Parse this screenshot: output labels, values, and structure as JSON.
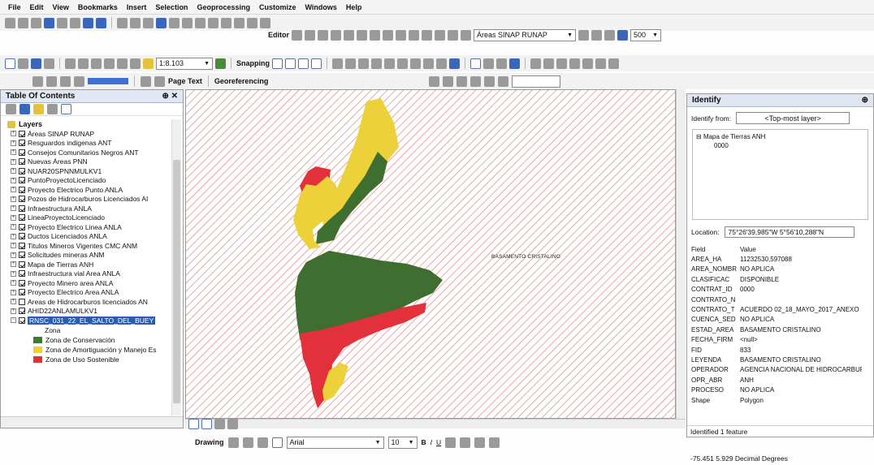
{
  "menu": [
    "File",
    "Edit",
    "View",
    "Bookmarks",
    "Insert",
    "Selection",
    "Geoprocessing",
    "Customize",
    "Windows",
    "Help"
  ],
  "toolbar": {
    "editor_label": "Editor",
    "target_layer": "Áreas SINAP RUNAP",
    "scale": "1:8.103",
    "snapping_label": "Snapping",
    "page_text_label": "Page Text",
    "georeferencing_label": "Georeferencing",
    "zoom_value": "500"
  },
  "toc": {
    "title": "Table Of Contents",
    "root": "Layers",
    "layers": [
      {
        "name": "Áreas SINAP RUNAP",
        "checked": true
      },
      {
        "name": "Resguardos indigenas ANT",
        "checked": true
      },
      {
        "name": "Consejos Comunitarios Negros ANT",
        "checked": true
      },
      {
        "name": "Nuevas Áreas PNN",
        "checked": true
      },
      {
        "name": "NUAR20SPNNMULKV1",
        "checked": true
      },
      {
        "name": "PuntoProyectoLicenciado",
        "checked": true
      },
      {
        "name": "Proyecto Electrico Punto ANLA",
        "checked": true
      },
      {
        "name": "Pozos de Hidrocarburos Licenciados AI",
        "checked": true
      },
      {
        "name": "Infraestructura ANLA",
        "checked": true
      },
      {
        "name": "LineaProyectoLicenciado",
        "checked": true
      },
      {
        "name": "Proyecto Electrico Linea ANLA",
        "checked": true
      },
      {
        "name": "Ductos Licenciados ANLA",
        "checked": true
      },
      {
        "name": "Titulos Mineros Vigentes CMC ANM",
        "checked": true
      },
      {
        "name": "Solicitudes mineras ANM",
        "checked": true
      },
      {
        "name": "Mapa de Tierras ANH",
        "checked": true
      },
      {
        "name": "Infraestructura vial Area ANLA",
        "checked": true
      },
      {
        "name": "Proyecto Minero area ANLA",
        "checked": true
      },
      {
        "name": "Proyecto Electrico Area ANLA",
        "checked": true
      },
      {
        "name": "Areas de Hidrocarburos licenciados AN",
        "checked": false
      },
      {
        "name": "AHID22ANLAMULKV1",
        "checked": true
      },
      {
        "name": "RNSC_031_22_EL_SALTO_DEL_BUEY",
        "checked": true,
        "selected": true
      }
    ],
    "legend_heading": "Zona",
    "legend": [
      {
        "label": "Zona de Conservación",
        "color": "#3a7d2c"
      },
      {
        "label": "Zona de Amortiguación y Manejo Es",
        "color": "#f0d030"
      },
      {
        "label": "Zona de Uso Sostenible",
        "color": "#e0303a"
      }
    ]
  },
  "map": {
    "label": "BASAMENTO CRISTALINO",
    "colors": {
      "hatch": "#d97a78",
      "green": "#3f6f30",
      "yellow": "#ecd13a",
      "red": "#e3313c"
    }
  },
  "identify": {
    "title": "Identify",
    "from_label": "Identify from:",
    "from_value": "<Top-most layer>",
    "tree_root": "Mapa de Tierras ANH",
    "tree_child": "0000",
    "location_label": "Location:",
    "location_value": "75°26'39,985\"W  5°56'10,288\"N",
    "field_header": "Field",
    "value_header": "Value",
    "attributes": [
      {
        "field": "AREA_HA",
        "value": "11232530,597088"
      },
      {
        "field": "AREA_NOMBR",
        "value": "NO APLICA"
      },
      {
        "field": "CLASIFICAC",
        "value": "DISPONIBLE"
      },
      {
        "field": "CONTRAT_ID",
        "value": "0000"
      },
      {
        "field": "CONTRATO_N",
        "value": ""
      },
      {
        "field": "CONTRATO_T",
        "value": "ACUERDO 02_18_MAYO_2017_ANEXO"
      },
      {
        "field": "CUENCA_SED",
        "value": "NO APLICA"
      },
      {
        "field": "ESTAD_AREA",
        "value": "BASAMENTO CRISTALINO"
      },
      {
        "field": "FECHA_FIRM",
        "value": "<null>"
      },
      {
        "field": "FID",
        "value": "833"
      },
      {
        "field": "LEYENDA",
        "value": "BASAMENTO CRISTALINO"
      },
      {
        "field": "OPERADOR",
        "value": "AGENCIA NACIONAL DE HIDROCARBURC"
      },
      {
        "field": "OPR_ABR",
        "value": "ANH"
      },
      {
        "field": "PROCESO",
        "value": "NO APLICA"
      },
      {
        "field": "Shape",
        "value": "Polygon"
      }
    ],
    "footer": "Identified 1 feature"
  },
  "drawing": {
    "label": "Drawing",
    "font": "Arial",
    "size": "10"
  },
  "status": {
    "coords": "-75.451  5.929 Decimal Degrees"
  }
}
